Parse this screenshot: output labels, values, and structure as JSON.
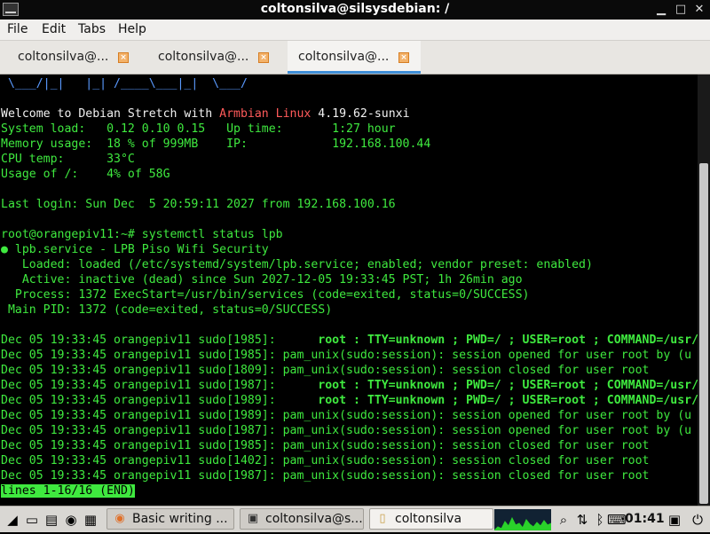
{
  "window": {
    "title": "coltonsilva@silsysdebian: /"
  },
  "menu": {
    "items": [
      "File",
      "Edit",
      "Tabs",
      "Help"
    ]
  },
  "tabs": [
    {
      "label": "coltonsilva@...",
      "active": false
    },
    {
      "label": "coltonsilva@...",
      "active": false
    },
    {
      "label": "coltonsilva@...",
      "active": true
    }
  ],
  "terminal": {
    "banner_tail": " \\___/|_|   |_| /____\\___|_|  \\___/",
    "welcome_prefix": "Welcome to Debian Stretch with ",
    "welcome_brand": "Armbian Linux",
    "welcome_suffix": " 4.19.62-sunxi",
    "sysinfo": [
      "System load:   0.12 0.10 0.15   Up time:       1:27 hour",
      "Memory usage:  18 % of 999MB    IP:            192.168.100.44",
      "CPU temp:      33°C",
      "Usage of /:    4% of 58G"
    ],
    "last_login": "Last login: Sun Dec  5 20:59:11 2027 from 192.168.100.16",
    "prompt": "root@orangepiv11:~# systemctl status lpb",
    "service": [
      "● lpb.service - LPB Piso Wifi Security",
      "   Loaded: loaded (/etc/systemd/system/lpb.service; enabled; vendor preset: enabled)",
      "   Active: inactive (dead) since Sun 2027-12-05 19:33:45 PST; 1h 26min ago",
      "  Process: 1372 ExecStart=/usr/bin/services (code=exited, status=0/SUCCESS)",
      " Main PID: 1372 (code=exited, status=0/SUCCESS)"
    ],
    "logs": [
      {
        "prefix": "Dec 05 19:33:45 orangepiv11 sudo[1985]:      ",
        "bold": "root : TTY=unknown ; PWD=/ ; USER=root ; COMMAND=/usr/",
        "rest": ""
      },
      {
        "prefix": "Dec 05 19:33:45 orangepiv11 sudo[1985]: ",
        "bold": "",
        "rest": "pam_unix(sudo:session): session opened for user root by (u"
      },
      {
        "prefix": "Dec 05 19:33:45 orangepiv11 sudo[1809]: ",
        "bold": "",
        "rest": "pam_unix(sudo:session): session closed for user root"
      },
      {
        "prefix": "Dec 05 19:33:45 orangepiv11 sudo[1987]:      ",
        "bold": "root : TTY=unknown ; PWD=/ ; USER=root ; COMMAND=/usr/",
        "rest": ""
      },
      {
        "prefix": "Dec 05 19:33:45 orangepiv11 sudo[1989]:      ",
        "bold": "root : TTY=unknown ; PWD=/ ; USER=root ; COMMAND=/usr/",
        "rest": ""
      },
      {
        "prefix": "Dec 05 19:33:45 orangepiv11 sudo[1989]: ",
        "bold": "",
        "rest": "pam_unix(sudo:session): session opened for user root by (u"
      },
      {
        "prefix": "Dec 05 19:33:45 orangepiv11 sudo[1987]: ",
        "bold": "",
        "rest": "pam_unix(sudo:session): session opened for user root by (u"
      },
      {
        "prefix": "Dec 05 19:33:45 orangepiv11 sudo[1985]: ",
        "bold": "",
        "rest": "pam_unix(sudo:session): session closed for user root"
      },
      {
        "prefix": "Dec 05 19:33:45 orangepiv11 sudo[1402]: ",
        "bold": "",
        "rest": "pam_unix(sudo:session): session closed for user root"
      },
      {
        "prefix": "Dec 05 19:33:45 orangepiv11 sudo[1987]: ",
        "bold": "",
        "rest": "pam_unix(sudo:session): session closed for user root"
      }
    ],
    "pager_status": "lines 1-16/16 (END)"
  },
  "taskbar": {
    "tasks": [
      {
        "label": "Basic writing ...",
        "icon": "firefox-icon"
      },
      {
        "label": "coltonsilva@s...",
        "icon": "terminal-icon"
      },
      {
        "label": "coltonsilva",
        "icon": "folder-icon"
      }
    ],
    "clock": "01:41",
    "colors": {
      "terminal_green": "#3fe93f",
      "brand_red": "#ff5a5a",
      "accent_blue": "#3f8fd8"
    }
  }
}
